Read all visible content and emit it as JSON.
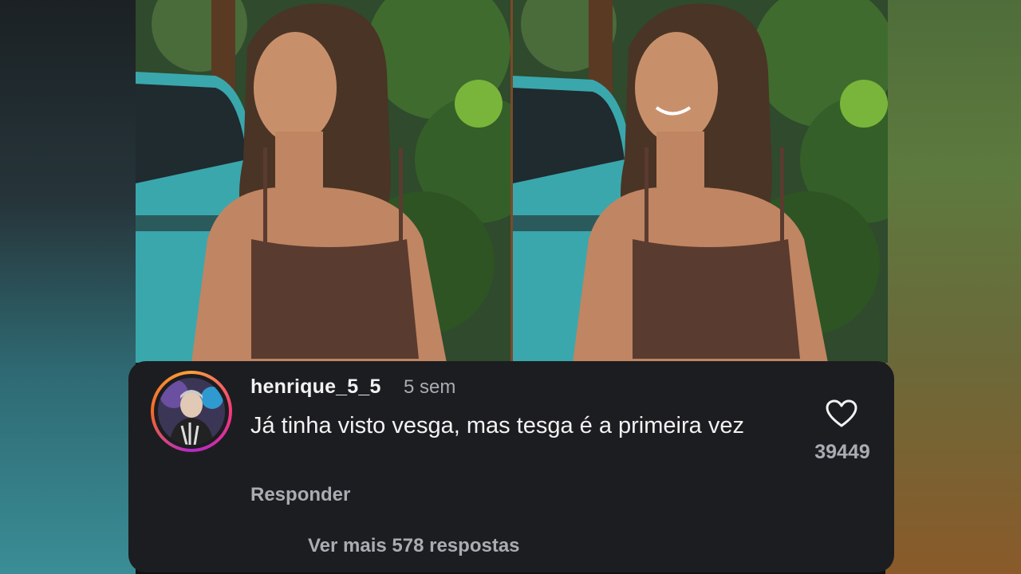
{
  "comment": {
    "username": "henrique_5_5",
    "time": "5 sem",
    "text": "Já tinha visto vesga, mas tesga é a primeira vez",
    "reply_label": "Responder",
    "likes": "39449",
    "more_replies": "Ver mais 578 respostas"
  },
  "icons": {
    "like": "heart-outline-icon",
    "avatar": "user-avatar"
  },
  "colors": {
    "card_background": "#1c1d20",
    "primary_text": "#f2f2f2",
    "secondary_text": "#a9acb2",
    "story_ring": [
      "#f9a13b",
      "#f4387b",
      "#b328c9"
    ]
  }
}
